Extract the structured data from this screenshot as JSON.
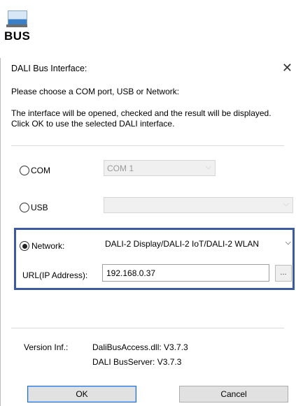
{
  "app_icon": {
    "label": "BUS",
    "icon": "bus-interface-icon"
  },
  "dialog": {
    "title": "DALI Bus Interface:",
    "close_glyph": "✕",
    "prompt": "Please choose a COM port, USB or Network:",
    "description": "The interface will be opened, checked and the result will be displayed. Click OK to use the selected DALI interface.",
    "options": {
      "com": {
        "label": "COM",
        "selected": false,
        "value": "COM 1",
        "enabled": false
      },
      "usb": {
        "label": "USB",
        "selected": false,
        "value": "",
        "enabled": false
      },
      "network": {
        "label": "Network:",
        "selected": true,
        "value": "DALI-2 Display/DALI-2 IoT/DALI-2 WLAN",
        "enabled": true
      }
    },
    "url": {
      "label": "URL(IP Address):",
      "value": "192.168.0.37",
      "browse_label": "..."
    },
    "version": {
      "label": "Version Inf.:",
      "dll": "DaliBusAccess.dll: V3.7.3",
      "server": "DALI BusServer: V3.7.3"
    },
    "buttons": {
      "ok": "OK",
      "cancel": "Cancel"
    }
  },
  "colors": {
    "highlight_border": "#3b5b9e",
    "default_button_border": "#1f6fd6"
  }
}
